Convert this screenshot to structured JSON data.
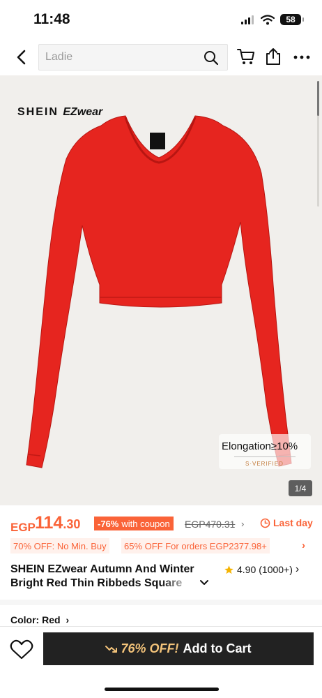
{
  "status_bar": {
    "time": "11:48",
    "battery": "58"
  },
  "nav": {
    "search_placeholder": "Ladie"
  },
  "image": {
    "brand_main": "SHEIN",
    "brand_sub": "EZwear",
    "badge_text": "Elongation≥10%",
    "verified_text": "S·VERIFIED",
    "page_indicator": "1/4",
    "garment_color": "#e6251f"
  },
  "price": {
    "currency": "EGP",
    "whole": "114",
    "cents": ".30",
    "discount": "-76%",
    "coupon_text": "with coupon",
    "original": "EGP470.31",
    "last_day": "Last day"
  },
  "promos": [
    "70% OFF: No Min. Buy",
    "65% OFF For orders EGP2377.98+"
  ],
  "product": {
    "title_line1": "SHEIN EZwear Autumn And Winter",
    "title_line2": "Bright Red Thin Ribbeds Square",
    "rating": "4.90",
    "review_count": "(1000+)"
  },
  "color": {
    "label": "Color: Red"
  },
  "cart": {
    "promo": "76% OFF!",
    "label": "Add to Cart"
  },
  "colors": {
    "accent": "#fa6338",
    "dark": "#222222"
  }
}
